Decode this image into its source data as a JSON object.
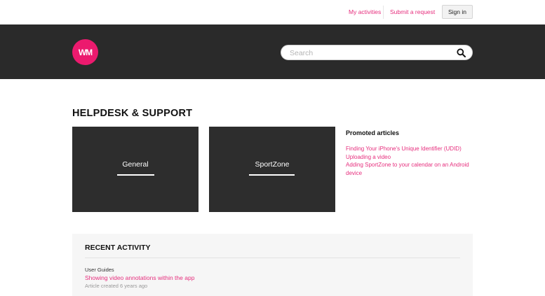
{
  "header": {
    "my_activities": "My activities",
    "submit_request": "Submit a request",
    "sign_in": "Sign in"
  },
  "brand": {
    "logo_text": "WM",
    "accent_color": "#ec1a6e",
    "hero_bg": "#2a2a2a"
  },
  "search": {
    "placeholder": "Search",
    "value": "",
    "icon": "search-icon"
  },
  "main": {
    "title": "HELPDESK & SUPPORT",
    "categories": [
      {
        "label": "General"
      },
      {
        "label": "SportZone"
      }
    ]
  },
  "promoted": {
    "title": "Promoted articles",
    "articles": [
      "Finding Your iPhone's Unique Identifier (UDID)",
      "Uploading a video",
      "Adding SportZone to your calendar on an Android device"
    ]
  },
  "recent_activity": {
    "title": "RECENT ACTIVITY",
    "items": [
      {
        "section": "User Guides",
        "article": "Showing video annotations within the app",
        "meta": "Article created 6 years ago"
      }
    ]
  }
}
